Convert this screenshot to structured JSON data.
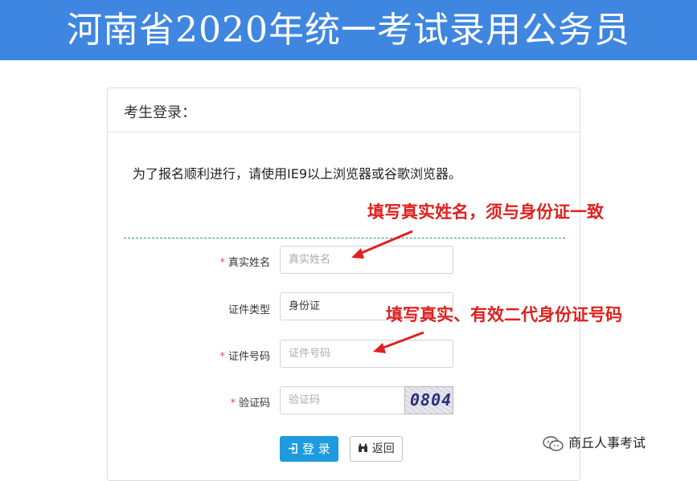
{
  "banner": {
    "title": "河南省2020年统一考试录用公务员"
  },
  "panel": {
    "heading": "考生登录：",
    "notice": "为了报名顺利进行，请使用IE9以上浏览器或谷歌浏览器。"
  },
  "form": {
    "name": {
      "label": "真实姓名",
      "required": "*",
      "placeholder": "真实姓名"
    },
    "id_type": {
      "label": "证件类型",
      "value": "身份证"
    },
    "id_number": {
      "label": "证件号码",
      "required": "*",
      "placeholder": "证件号码"
    },
    "captcha": {
      "label": "验证码",
      "required": "*",
      "placeholder": "验证码",
      "image_text": "0804"
    },
    "login_label": "登 录",
    "back_label": "返回"
  },
  "annotations": {
    "name_hint": "填写真实姓名，须与身份证一致",
    "id_hint": "填写真实、有效二代身份证号码"
  },
  "watermark": {
    "text": "商丘人事考试"
  },
  "colors": {
    "banner": "#3f86e0",
    "primary_button": "#1e9bdf",
    "annotation": "#e0201f"
  }
}
